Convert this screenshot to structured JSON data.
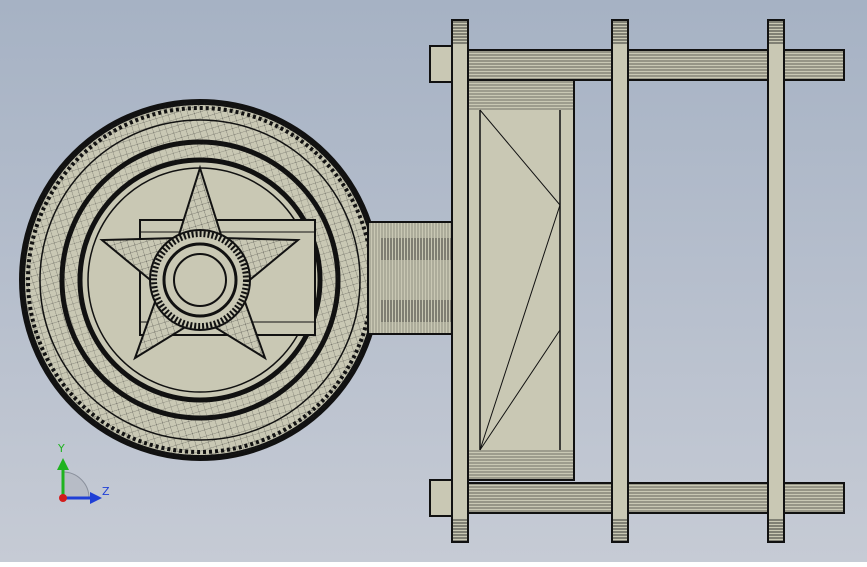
{
  "viewport": {
    "background_top": "#a9b4c5",
    "background_bottom": "#c4c9d3",
    "model_fill": "#c9c8b4",
    "edge_color": "#111111"
  },
  "triad": {
    "y_label": "Y",
    "z_label": "Z",
    "y_color": "#1fb31f",
    "z_color": "#1f3fd6",
    "x_color": "#d21c1c"
  }
}
